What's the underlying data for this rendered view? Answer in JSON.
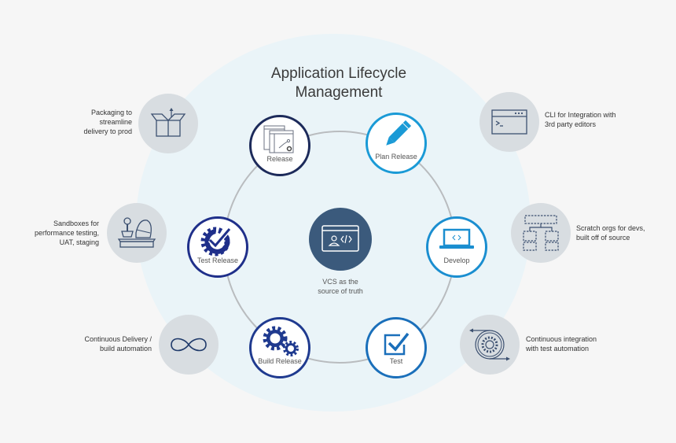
{
  "title": {
    "line1": "Application Lifecycle",
    "line2": "Management"
  },
  "colors": {
    "background": "#f6f6f6",
    "circle_bg": "#eaf4f8",
    "dark_navy": "#1c2a5a",
    "navy": "#1f3a8f",
    "light_blue": "#1a9ad6",
    "mid_blue": "#1a6fba",
    "center_fill": "#3b5a7c",
    "side_fill": "#d8dde1",
    "icon_gray": "#3c5070"
  },
  "center": {
    "icon": "code-window-icon",
    "line1": "VCS as the",
    "line2": "source of truth"
  },
  "cycle": [
    {
      "label": "Release",
      "icon": "release-dashboard-icon"
    },
    {
      "label": "Plan Release",
      "icon": "pencil-icon"
    },
    {
      "label": "Develop",
      "icon": "laptop-code-icon"
    },
    {
      "label": "Test",
      "icon": "checkbox-icon"
    },
    {
      "label": "Build Release",
      "icon": "gears-icon"
    },
    {
      "label": "Test Release",
      "icon": "gear-check-icon"
    }
  ],
  "left_features": [
    {
      "icon": "package-box-icon",
      "lines": [
        "Packaging to",
        "streamline",
        "delivery to prod"
      ]
    },
    {
      "icon": "sandbox-icon",
      "lines": [
        "Sandboxes for",
        "performance testing,",
        "UAT, staging"
      ]
    },
    {
      "icon": "infinity-icon",
      "lines": [
        "Continuous Delivery /",
        "build automation"
      ]
    }
  ],
  "right_features": [
    {
      "icon": "terminal-window-icon",
      "lines": [
        "CLI for Integration with",
        "3rd party editors"
      ]
    },
    {
      "icon": "org-chart-dashed-icon",
      "lines": [
        "Scratch orgs for devs,",
        "built off of source"
      ]
    },
    {
      "icon": "gear-cycle-icon",
      "lines": [
        "Continuous integration",
        "with test automation"
      ]
    }
  ]
}
